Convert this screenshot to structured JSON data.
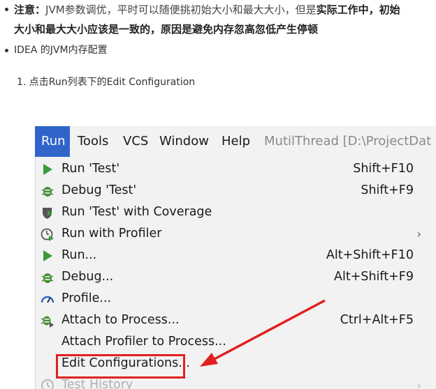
{
  "article": {
    "note_label": "注意：",
    "note_text_1": "JVM参数调优，平时可以随便挑初始大小和最大大小，但是",
    "note_bold_1": "实际工作中，初始",
    "note_bold_2": "大小和最大大小应该是一致的，原因是避免内存忽高忽低产生停顿",
    "bullet_idea": "IDEA 的JVM内存配置",
    "step_1": "1. 点击Run列表下的Edit Configuration"
  },
  "menubar": {
    "run": "Run",
    "tools": "Tools",
    "vcs": "VCS",
    "window": "Window",
    "help": "Help",
    "project_title": "MutilThread [D:\\ProjectDat"
  },
  "run_menu": {
    "items": [
      {
        "label": "Run 'Test'",
        "shortcut": "Shift+F10",
        "icon": "run-icon"
      },
      {
        "label": "Debug 'Test'",
        "shortcut": "Shift+F9",
        "icon": "debug-icon"
      },
      {
        "label": "Run 'Test' with Coverage",
        "shortcut": "",
        "icon": "coverage-icon"
      },
      {
        "label": "Run with Profiler",
        "shortcut": "",
        "icon": "profiler-icon",
        "submenu": "›"
      },
      {
        "label": "Run...",
        "shortcut": "Alt+Shift+F10",
        "icon": "run-icon"
      },
      {
        "label": "Debug...",
        "shortcut": "Alt+Shift+F9",
        "icon": "debug-icon"
      },
      {
        "label": "Profile...",
        "shortcut": "",
        "icon": "profile-gauge-icon"
      },
      {
        "label": "Attach to Process...",
        "shortcut": "Ctrl+Alt+F5",
        "icon": "attach-debug-icon"
      },
      {
        "label": "Attach Profiler to Process...",
        "shortcut": "",
        "icon": ""
      },
      {
        "label": "Edit Configurations...",
        "shortcut": "",
        "icon": ""
      },
      {
        "label": "Test History",
        "shortcut": "",
        "icon": "history-icon",
        "submenu": "›"
      }
    ]
  },
  "colors": {
    "menu_active": "#2f65ca",
    "run_green": "#3d9a3d",
    "annotation_red": "#e02020"
  }
}
